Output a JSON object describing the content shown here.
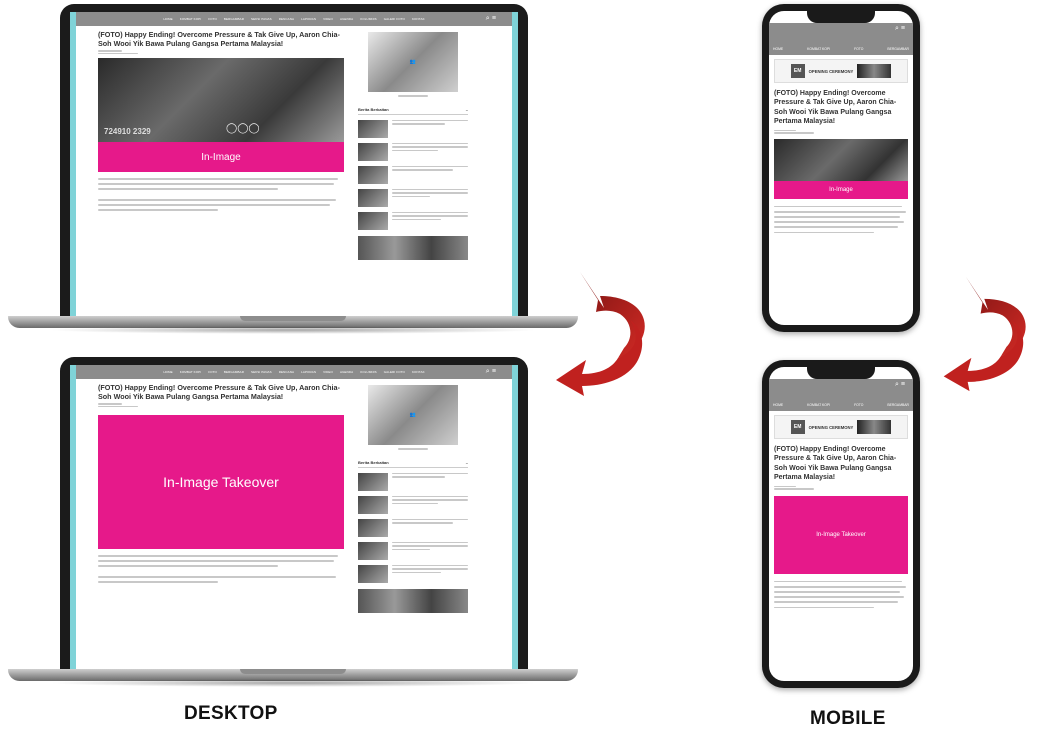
{
  "article": {
    "title": "(FOTO) Happy Ending! Overcome Pressure & Tak Give Up, Aaron Chia-Soh Wooi Yik Bawa Pulang Gangsa Pertama Malaysia!",
    "mobile_title": "(FOTO) Happy Ending! Overcome Pressure & Tak Give Up, Aaron Chia-Soh Wooi Yik Bawa Pulang Gangsa Pertama Malaysia!",
    "photo_score": "724910 2329"
  },
  "nav": {
    "desktop_links": [
      "HOME",
      "KOMBAT KOPI",
      "FOTO",
      "BERGAMBAR",
      "SEKSI PANAS",
      "RENCANA",
      "LAPORAN",
      "VIDEO",
      "AGENDA",
      "KOLUMNIS",
      "GALERI FOTO",
      "KONTAK"
    ],
    "mobile_links": [
      "HOME",
      "KOMBAT KOPI",
      "FOTO",
      "BERGAMBAR"
    ]
  },
  "sidebar": {
    "related_heading": "Berita Berkaitan"
  },
  "mobile": {
    "logo_text": "EM",
    "ceremony_text": "OPENING CEREMONY"
  },
  "ads": {
    "in_image": "In-Image",
    "in_image_takeover": "In-Image Takeover",
    "mobile_in_image_takeover": "In-Image Takeover"
  },
  "labels": {
    "desktop": "DESKTOP",
    "mobile": "MOBILE"
  },
  "colors": {
    "ad_magenta": "#e6198a",
    "arrow_red": "#c0211f",
    "nav_gray": "#8c8c8c",
    "screen_frame_teal": "#7fd3d8"
  }
}
